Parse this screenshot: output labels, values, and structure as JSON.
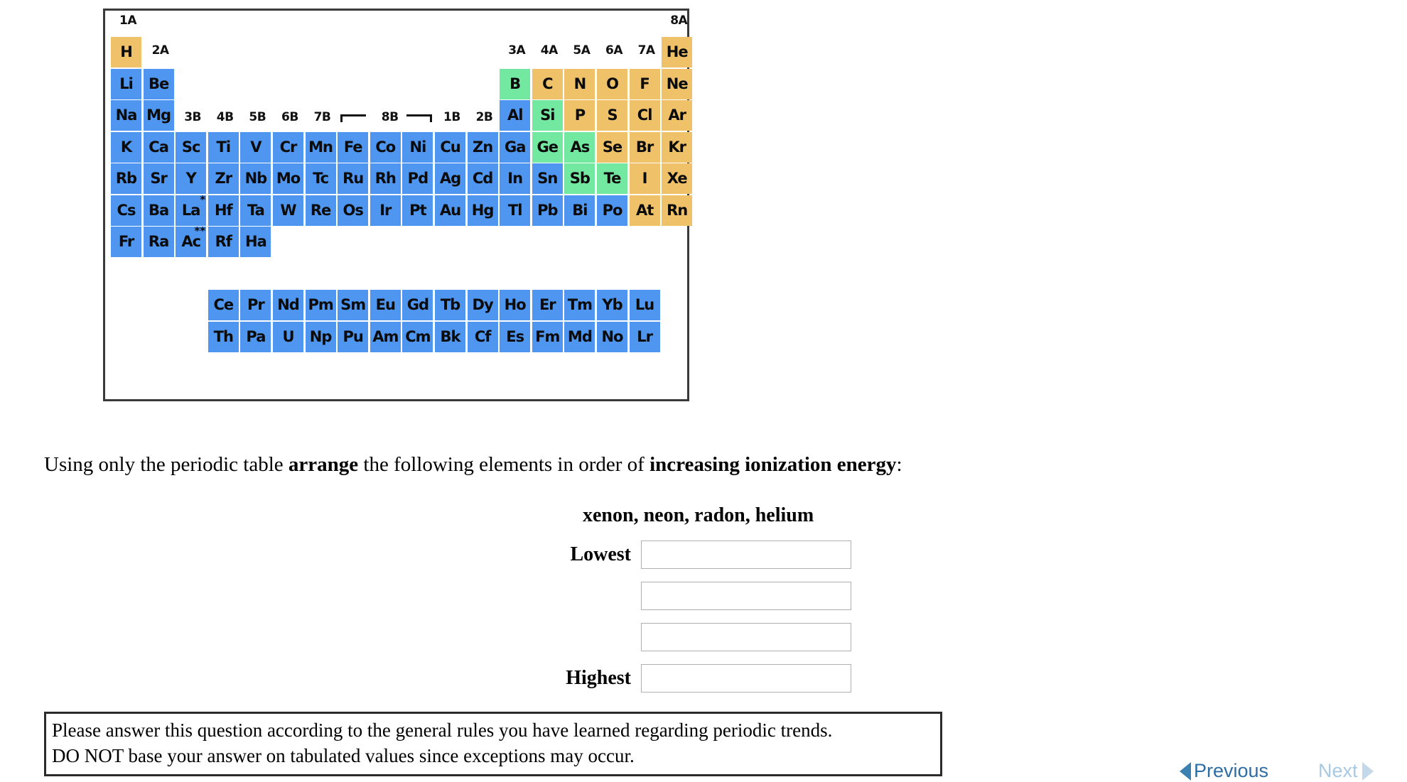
{
  "periodic_table": {
    "title": "periodic-table-figure",
    "colors": {
      "metal_blue": "#4e96ef",
      "metalloid_green": "#72e8a0",
      "nonmetal_orange": "#efc169",
      "border": "#3a3a3a"
    },
    "group_labels": [
      {
        "text": "1A",
        "col": 0,
        "row_label": "top"
      },
      {
        "text": "2A",
        "col": 1,
        "row_label": "period1"
      },
      {
        "text": "3B",
        "col": 2,
        "row_label": "period3"
      },
      {
        "text": "4B",
        "col": 3,
        "row_label": "period3"
      },
      {
        "text": "5B",
        "col": 4,
        "row_label": "period3"
      },
      {
        "text": "6B",
        "col": 5,
        "row_label": "period3"
      },
      {
        "text": "7B",
        "col": 6,
        "row_label": "period3"
      },
      {
        "text": "8B",
        "col": 8,
        "row_label": "period3"
      },
      {
        "text": "1B",
        "col": 10,
        "row_label": "period3"
      },
      {
        "text": "2B",
        "col": 11,
        "row_label": "period3"
      },
      {
        "text": "3A",
        "col": 12,
        "row_label": "period1"
      },
      {
        "text": "4A",
        "col": 13,
        "row_label": "period1"
      },
      {
        "text": "5A",
        "col": 14,
        "row_label": "period1"
      },
      {
        "text": "6A",
        "col": 15,
        "row_label": "period1"
      },
      {
        "text": "7A",
        "col": 16,
        "row_label": "period1"
      },
      {
        "text": "8A",
        "col": 17,
        "row_label": "top"
      }
    ],
    "elements": [
      {
        "sym": "H",
        "col": 0,
        "row": 0,
        "color": "orange"
      },
      {
        "sym": "He",
        "col": 17,
        "row": 0,
        "color": "orange"
      },
      {
        "sym": "Li",
        "col": 0,
        "row": 1,
        "color": "blue"
      },
      {
        "sym": "Be",
        "col": 1,
        "row": 1,
        "color": "blue"
      },
      {
        "sym": "B",
        "col": 12,
        "row": 1,
        "color": "green"
      },
      {
        "sym": "C",
        "col": 13,
        "row": 1,
        "color": "orange"
      },
      {
        "sym": "N",
        "col": 14,
        "row": 1,
        "color": "orange"
      },
      {
        "sym": "O",
        "col": 15,
        "row": 1,
        "color": "orange"
      },
      {
        "sym": "F",
        "col": 16,
        "row": 1,
        "color": "orange"
      },
      {
        "sym": "Ne",
        "col": 17,
        "row": 1,
        "color": "orange"
      },
      {
        "sym": "Na",
        "col": 0,
        "row": 2,
        "color": "blue"
      },
      {
        "sym": "Mg",
        "col": 1,
        "row": 2,
        "color": "blue"
      },
      {
        "sym": "Al",
        "col": 12,
        "row": 2,
        "color": "blue"
      },
      {
        "sym": "Si",
        "col": 13,
        "row": 2,
        "color": "green"
      },
      {
        "sym": "P",
        "col": 14,
        "row": 2,
        "color": "orange"
      },
      {
        "sym": "S",
        "col": 15,
        "row": 2,
        "color": "orange"
      },
      {
        "sym": "Cl",
        "col": 16,
        "row": 2,
        "color": "orange"
      },
      {
        "sym": "Ar",
        "col": 17,
        "row": 2,
        "color": "orange"
      },
      {
        "sym": "K",
        "col": 0,
        "row": 3,
        "color": "blue"
      },
      {
        "sym": "Ca",
        "col": 1,
        "row": 3,
        "color": "blue"
      },
      {
        "sym": "Sc",
        "col": 2,
        "row": 3,
        "color": "blue"
      },
      {
        "sym": "Ti",
        "col": 3,
        "row": 3,
        "color": "blue"
      },
      {
        "sym": "V",
        "col": 4,
        "row": 3,
        "color": "blue"
      },
      {
        "sym": "Cr",
        "col": 5,
        "row": 3,
        "color": "blue"
      },
      {
        "sym": "Mn",
        "col": 6,
        "row": 3,
        "color": "blue"
      },
      {
        "sym": "Fe",
        "col": 7,
        "row": 3,
        "color": "blue"
      },
      {
        "sym": "Co",
        "col": 8,
        "row": 3,
        "color": "blue"
      },
      {
        "sym": "Ni",
        "col": 9,
        "row": 3,
        "color": "blue"
      },
      {
        "sym": "Cu",
        "col": 10,
        "row": 3,
        "color": "blue"
      },
      {
        "sym": "Zn",
        "col": 11,
        "row": 3,
        "color": "blue"
      },
      {
        "sym": "Ga",
        "col": 12,
        "row": 3,
        "color": "blue"
      },
      {
        "sym": "Ge",
        "col": 13,
        "row": 3,
        "color": "green"
      },
      {
        "sym": "As",
        "col": 14,
        "row": 3,
        "color": "green"
      },
      {
        "sym": "Se",
        "col": 15,
        "row": 3,
        "color": "orange"
      },
      {
        "sym": "Br",
        "col": 16,
        "row": 3,
        "color": "orange"
      },
      {
        "sym": "Kr",
        "col": 17,
        "row": 3,
        "color": "orange"
      },
      {
        "sym": "Rb",
        "col": 0,
        "row": 4,
        "color": "blue"
      },
      {
        "sym": "Sr",
        "col": 1,
        "row": 4,
        "color": "blue"
      },
      {
        "sym": "Y",
        "col": 2,
        "row": 4,
        "color": "blue"
      },
      {
        "sym": "Zr",
        "col": 3,
        "row": 4,
        "color": "blue"
      },
      {
        "sym": "Nb",
        "col": 4,
        "row": 4,
        "color": "blue"
      },
      {
        "sym": "Mo",
        "col": 5,
        "row": 4,
        "color": "blue"
      },
      {
        "sym": "Tc",
        "col": 6,
        "row": 4,
        "color": "blue"
      },
      {
        "sym": "Ru",
        "col": 7,
        "row": 4,
        "color": "blue"
      },
      {
        "sym": "Rh",
        "col": 8,
        "row": 4,
        "color": "blue"
      },
      {
        "sym": "Pd",
        "col": 9,
        "row": 4,
        "color": "blue"
      },
      {
        "sym": "Ag",
        "col": 10,
        "row": 4,
        "color": "blue"
      },
      {
        "sym": "Cd",
        "col": 11,
        "row": 4,
        "color": "blue"
      },
      {
        "sym": "In",
        "col": 12,
        "row": 4,
        "color": "blue"
      },
      {
        "sym": "Sn",
        "col": 13,
        "row": 4,
        "color": "blue"
      },
      {
        "sym": "Sb",
        "col": 14,
        "row": 4,
        "color": "green"
      },
      {
        "sym": "Te",
        "col": 15,
        "row": 4,
        "color": "green"
      },
      {
        "sym": "I",
        "col": 16,
        "row": 4,
        "color": "orange"
      },
      {
        "sym": "Xe",
        "col": 17,
        "row": 4,
        "color": "orange"
      },
      {
        "sym": "Cs",
        "col": 0,
        "row": 5,
        "color": "blue"
      },
      {
        "sym": "Ba",
        "col": 1,
        "row": 5,
        "color": "blue"
      },
      {
        "sym": "La",
        "col": 2,
        "row": 5,
        "color": "blue",
        "sup": "*"
      },
      {
        "sym": "Hf",
        "col": 3,
        "row": 5,
        "color": "blue"
      },
      {
        "sym": "Ta",
        "col": 4,
        "row": 5,
        "color": "blue"
      },
      {
        "sym": "W",
        "col": 5,
        "row": 5,
        "color": "blue"
      },
      {
        "sym": "Re",
        "col": 6,
        "row": 5,
        "color": "blue"
      },
      {
        "sym": "Os",
        "col": 7,
        "row": 5,
        "color": "blue"
      },
      {
        "sym": "Ir",
        "col": 8,
        "row": 5,
        "color": "blue"
      },
      {
        "sym": "Pt",
        "col": 9,
        "row": 5,
        "color": "blue"
      },
      {
        "sym": "Au",
        "col": 10,
        "row": 5,
        "color": "blue"
      },
      {
        "sym": "Hg",
        "col": 11,
        "row": 5,
        "color": "blue"
      },
      {
        "sym": "Tl",
        "col": 12,
        "row": 5,
        "color": "blue"
      },
      {
        "sym": "Pb",
        "col": 13,
        "row": 5,
        "color": "blue"
      },
      {
        "sym": "Bi",
        "col": 14,
        "row": 5,
        "color": "blue"
      },
      {
        "sym": "Po",
        "col": 15,
        "row": 5,
        "color": "blue"
      },
      {
        "sym": "At",
        "col": 16,
        "row": 5,
        "color": "orange"
      },
      {
        "sym": "Rn",
        "col": 17,
        "row": 5,
        "color": "orange"
      },
      {
        "sym": "Fr",
        "col": 0,
        "row": 6,
        "color": "blue"
      },
      {
        "sym": "Ra",
        "col": 1,
        "row": 6,
        "color": "blue"
      },
      {
        "sym": "Ac",
        "col": 2,
        "row": 6,
        "color": "blue",
        "sup": "**"
      },
      {
        "sym": "Rf",
        "col": 3,
        "row": 6,
        "color": "blue"
      },
      {
        "sym": "Ha",
        "col": 4,
        "row": 6,
        "color": "blue"
      },
      {
        "sym": "Ce",
        "col": 3,
        "row": 8,
        "color": "blue"
      },
      {
        "sym": "Pr",
        "col": 4,
        "row": 8,
        "color": "blue"
      },
      {
        "sym": "Nd",
        "col": 5,
        "row": 8,
        "color": "blue"
      },
      {
        "sym": "Pm",
        "col": 6,
        "row": 8,
        "color": "blue"
      },
      {
        "sym": "Sm",
        "col": 7,
        "row": 8,
        "color": "blue"
      },
      {
        "sym": "Eu",
        "col": 8,
        "row": 8,
        "color": "blue"
      },
      {
        "sym": "Gd",
        "col": 9,
        "row": 8,
        "color": "blue"
      },
      {
        "sym": "Tb",
        "col": 10,
        "row": 8,
        "color": "blue"
      },
      {
        "sym": "Dy",
        "col": 11,
        "row": 8,
        "color": "blue"
      },
      {
        "sym": "Ho",
        "col": 12,
        "row": 8,
        "color": "blue"
      },
      {
        "sym": "Er",
        "col": 13,
        "row": 8,
        "color": "blue"
      },
      {
        "sym": "Tm",
        "col": 14,
        "row": 8,
        "color": "blue"
      },
      {
        "sym": "Yb",
        "col": 15,
        "row": 8,
        "color": "blue"
      },
      {
        "sym": "Lu",
        "col": 16,
        "row": 8,
        "color": "blue"
      },
      {
        "sym": "Th",
        "col": 3,
        "row": 9,
        "color": "blue"
      },
      {
        "sym": "Pa",
        "col": 4,
        "row": 9,
        "color": "blue"
      },
      {
        "sym": "U",
        "col": 5,
        "row": 9,
        "color": "blue"
      },
      {
        "sym": "Np",
        "col": 6,
        "row": 9,
        "color": "blue"
      },
      {
        "sym": "Pu",
        "col": 7,
        "row": 9,
        "color": "blue"
      },
      {
        "sym": "Am",
        "col": 8,
        "row": 9,
        "color": "blue"
      },
      {
        "sym": "Cm",
        "col": 9,
        "row": 9,
        "color": "blue"
      },
      {
        "sym": "Bk",
        "col": 10,
        "row": 9,
        "color": "blue"
      },
      {
        "sym": "Cf",
        "col": 11,
        "row": 9,
        "color": "blue"
      },
      {
        "sym": "Es",
        "col": 12,
        "row": 9,
        "color": "blue"
      },
      {
        "sym": "Fm",
        "col": 13,
        "row": 9,
        "color": "blue"
      },
      {
        "sym": "Md",
        "col": 14,
        "row": 9,
        "color": "blue"
      },
      {
        "sym": "No",
        "col": 15,
        "row": 9,
        "color": "blue"
      },
      {
        "sym": "Lr",
        "col": 16,
        "row": 9,
        "color": "blue"
      }
    ]
  },
  "question": {
    "prompt_part1": "Using only the periodic table ",
    "prompt_bold1": "arrange",
    "prompt_part2": " the following elements in order of ",
    "prompt_bold2": "increasing ionization energy",
    "prompt_part3": ":",
    "element_list": "xenon, neon, radon, helium"
  },
  "answer_rows": [
    {
      "label": "Lowest",
      "value": "",
      "placeholder": ""
    },
    {
      "label": "",
      "value": "",
      "placeholder": ""
    },
    {
      "label": "",
      "value": "",
      "placeholder": ""
    },
    {
      "label": "Highest",
      "value": "",
      "placeholder": ""
    }
  ],
  "note": {
    "line1": "Please answer this question according to the general rules you have learned regarding periodic trends.",
    "line2": "DO NOT base your answer on tabulated values since exceptions may occur."
  },
  "footer": {
    "previous_label": "Previous",
    "next_label": "Next",
    "previous_color": "#2e6da4",
    "next_color": "#a8c9e4"
  }
}
